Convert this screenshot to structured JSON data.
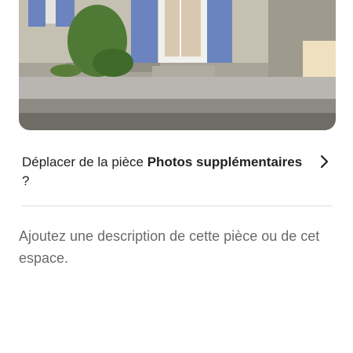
{
  "photo": {
    "alt": "",
    "icon": "room-photo"
  },
  "move_row": {
    "prefix": "Déplacer de la pièce",
    "room": "Photos supplémentaires",
    "suffix": "?",
    "icon": "chevron-right-icon"
  },
  "description": {
    "placeholder": "Ajoutez une description de cette pièce ou de cet espace."
  },
  "colors": {
    "text": "#222222",
    "muted": "#6a6a6a",
    "divider": "#dddddd",
    "shutter_blue": "#6b84c0"
  }
}
